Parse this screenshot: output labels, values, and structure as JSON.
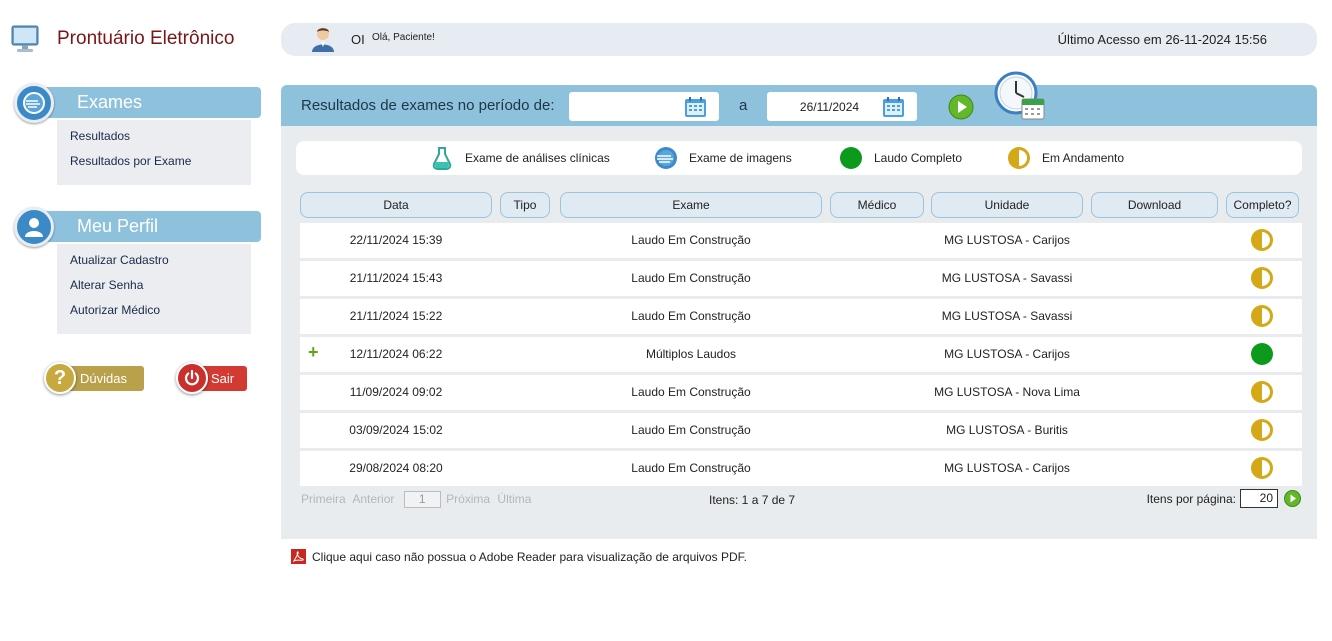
{
  "app": {
    "title": "Prontuário Eletrônico",
    "icon": "monitor-icon"
  },
  "topbar": {
    "greeting": "OI",
    "hello": "Olá, Paciente!",
    "last_access": "Último Acesso em 26-11-2024 15:56"
  },
  "menus": [
    {
      "title": "Exames",
      "icon": "exam-disc-icon",
      "items": [
        "Resultados",
        "Resultados por Exame"
      ]
    },
    {
      "title": "Meu Perfil",
      "icon": "user-icon",
      "items": [
        "Atualizar Cadastro",
        "Alterar Senha",
        "Autorizar Médico"
      ]
    }
  ],
  "actions": {
    "help": "Dúvidas",
    "exit": "Sair"
  },
  "filter": {
    "label": "Resultados de exames no período de:",
    "start_date": "",
    "separator": "a",
    "end_date": "26/11/2024"
  },
  "legend": {
    "lab": "Exame de análises clínicas",
    "imaging": "Exame de imagens",
    "complete": "Laudo Completo",
    "in_progress": "Em Andamento"
  },
  "colors": {
    "complete": "#0c9a1d",
    "in_progress": "#d4a817",
    "accent": "#8ec1dc"
  },
  "table": {
    "columns": [
      "Data",
      "Tipo",
      "Exame",
      "Médico",
      "Unidade",
      "Download",
      "Completo?"
    ],
    "rows": [
      {
        "expand": false,
        "date": "22/11/2024 15:39",
        "exam": "Laudo Em Construção",
        "unit": "MG LUSTOSA - Carijos",
        "status": "in_progress"
      },
      {
        "expand": false,
        "date": "21/11/2024 15:43",
        "exam": "Laudo Em Construção",
        "unit": "MG LUSTOSA - Savassi",
        "status": "in_progress"
      },
      {
        "expand": false,
        "date": "21/11/2024 15:22",
        "exam": "Laudo Em Construção",
        "unit": "MG LUSTOSA - Savassi",
        "status": "in_progress"
      },
      {
        "expand": true,
        "date": "12/11/2024 06:22",
        "exam": "Múltiplos Laudos",
        "unit": "MG LUSTOSA - Carijos",
        "status": "complete"
      },
      {
        "expand": false,
        "date": "11/09/2024 09:02",
        "exam": "Laudo Em Construção",
        "unit": "MG LUSTOSA - Nova Lima",
        "status": "in_progress"
      },
      {
        "expand": false,
        "date": "03/09/2024 15:02",
        "exam": "Laudo Em Construção",
        "unit": "MG LUSTOSA - Buritis",
        "status": "in_progress"
      },
      {
        "expand": false,
        "date": "29/08/2024 08:20",
        "exam": "Laudo Em Construção",
        "unit": "MG LUSTOSA - Carijos",
        "status": "in_progress"
      }
    ]
  },
  "pager": {
    "first": "Primeira",
    "prev": "Anterior",
    "page": "1",
    "next": "Próxima",
    "last": "Última",
    "items_info": "Itens: 1 a 7 de 7",
    "per_page_label": "Itens por página:",
    "per_page": "20"
  },
  "footer": {
    "pdf_notice": "Clique aqui caso não possua o Adobe Reader para visualização de arquivos PDF."
  }
}
